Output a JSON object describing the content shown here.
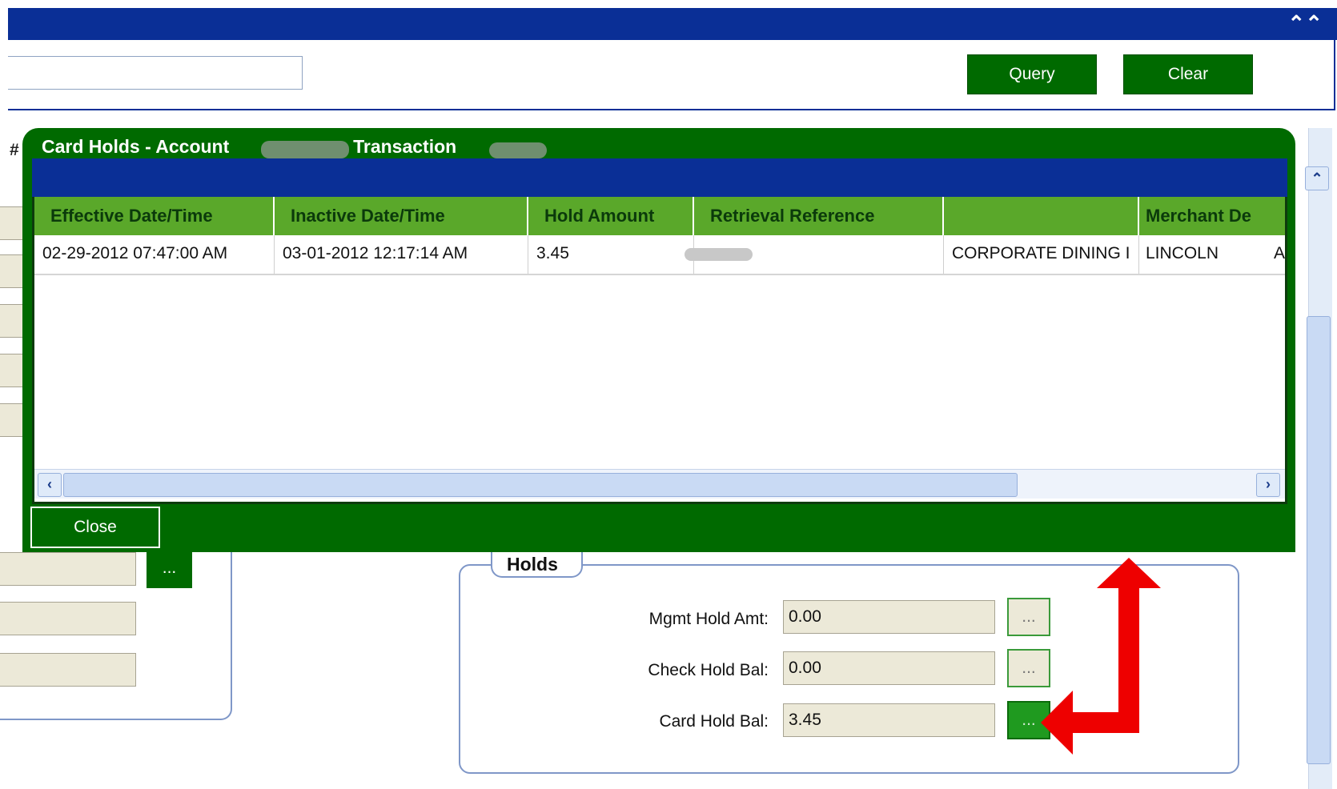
{
  "top": {
    "query_label": "Query",
    "clear_label": "Clear",
    "collapse_glyph": "⌃"
  },
  "page": {
    "hash_mark": "#",
    "bg_ellipsis": "..."
  },
  "dialog": {
    "title_prefix": "Card Holds - Account",
    "title_mid": "- Transaction",
    "columns": [
      "Effective Date/Time",
      "Inactive Date/Time",
      "Hold Amount",
      "Retrieval Reference",
      "",
      "Merchant De"
    ],
    "rows": [
      {
        "effective": "02-29-2012 07:47:00 AM",
        "inactive": "03-01-2012 12:17:14 AM",
        "amount": "3.45",
        "merchant_name": "CORPORATE DINING I",
        "city": "LINCOLN",
        "state_partial": "A"
      }
    ],
    "close_label": "Close"
  },
  "holds": {
    "legend": "Holds",
    "items": [
      {
        "label": "Mgmt Hold Amt:",
        "value": "0.00",
        "button": "..."
      },
      {
        "label": "Check Hold Bal:",
        "value": "0.00",
        "button": "..."
      },
      {
        "label": "Card Hold Bal:",
        "value": "3.45",
        "button": "..."
      }
    ]
  },
  "colors": {
    "navy": "#0a2f96",
    "green": "#006a00",
    "header_green": "#5aa82a",
    "arrow_red": "#ee0000"
  },
  "icons": [
    "collapse-up-icon",
    "scroll-left-icon",
    "scroll-right-icon",
    "scroll-up-icon"
  ]
}
